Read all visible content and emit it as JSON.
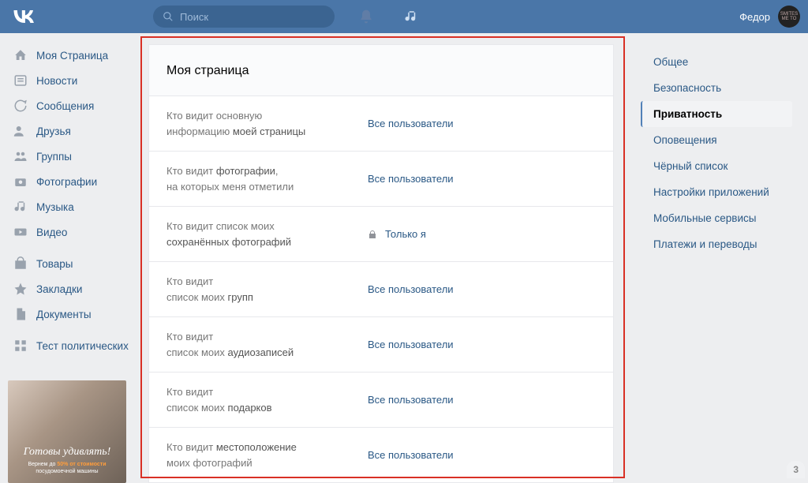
{
  "top": {
    "search_placeholder": "Поиск",
    "user_name": "Федор"
  },
  "nav": {
    "items": [
      {
        "label": "Моя Страница"
      },
      {
        "label": "Новости"
      },
      {
        "label": "Сообщения"
      },
      {
        "label": "Друзья"
      },
      {
        "label": "Группы"
      },
      {
        "label": "Фотографии"
      },
      {
        "label": "Музыка"
      },
      {
        "label": "Видео"
      }
    ],
    "items2": [
      {
        "label": "Товары"
      },
      {
        "label": "Закладки"
      },
      {
        "label": "Документы"
      }
    ],
    "items3": [
      {
        "label": "Тест политических"
      }
    ]
  },
  "ad": {
    "title": "Готовы удивлять!",
    "line1": "Вернем до",
    "highlight": "50% от стоимости",
    "line2": "посудомоечной машины"
  },
  "card": {
    "title": "Моя страница",
    "rows": [
      {
        "l1": "Кто видит основную",
        "l2": "информацию ",
        "b": "моей страницы",
        "value": "Все пользователи",
        "lock": false
      },
      {
        "l1": "Кто видит ",
        "b1": "фотографии",
        "l2": "на которых меня отметили",
        "value": "Все пользователи",
        "lock": false
      },
      {
        "l1": "Кто видит список моих",
        "b": "сохранённых фотографий",
        "value": "Только я",
        "lock": true
      },
      {
        "l1": "Кто видит",
        "l2": "список моих ",
        "b": "групп",
        "value": "Все пользователи",
        "lock": false
      },
      {
        "l1": "Кто видит",
        "l2": "список моих ",
        "b": "аудиозаписей",
        "value": "Все пользователи",
        "lock": false
      },
      {
        "l1": "Кто видит",
        "l2": "список моих ",
        "b": "подарков",
        "value": "Все пользователи",
        "lock": false
      },
      {
        "l1": "Кто видит ",
        "b1": "местоположение",
        "l2": "моих фотографий",
        "value": "Все пользователи",
        "lock": false
      }
    ]
  },
  "tabs": {
    "items": [
      {
        "label": "Общее"
      },
      {
        "label": "Безопасность"
      },
      {
        "label": "Приватность",
        "active": true
      },
      {
        "label": "Оповещения"
      },
      {
        "label": "Чёрный список"
      },
      {
        "label": "Настройки приложений"
      },
      {
        "label": "Мобильные сервисы"
      },
      {
        "label": "Платежи и переводы"
      }
    ]
  },
  "pill": "3"
}
